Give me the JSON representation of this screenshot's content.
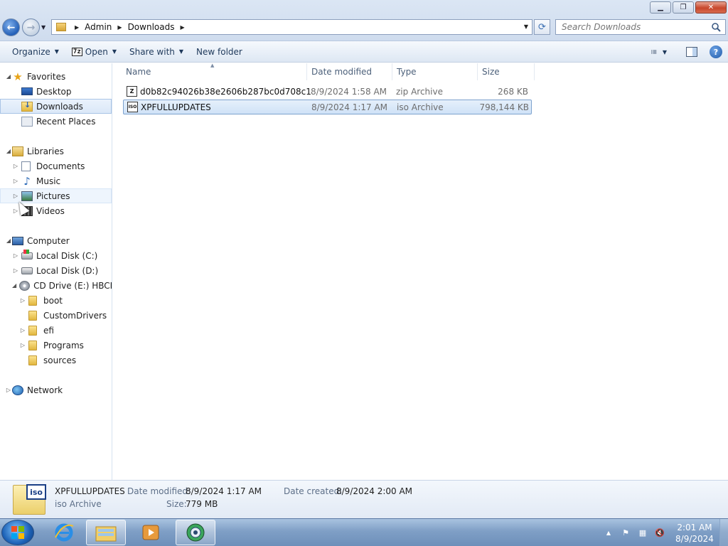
{
  "window": {
    "minimize": "▁",
    "restore": "❐",
    "close": "✕"
  },
  "address_bar": {
    "crumbs": [
      "Admin",
      "Downloads"
    ]
  },
  "search": {
    "placeholder": "Search Downloads"
  },
  "toolbar": {
    "organize": "Organize",
    "open_badge": "7z",
    "open": "Open",
    "share_with": "Share with",
    "new_folder": "New folder",
    "help": "?"
  },
  "nav": {
    "favorites": "Favorites",
    "desktop": "Desktop",
    "downloads": "Downloads",
    "recent_places": "Recent Places",
    "libraries": "Libraries",
    "documents": "Documents",
    "music": "Music",
    "pictures": "Pictures",
    "videos": "Videos",
    "computer": "Computer",
    "local_c": "Local Disk (C:)",
    "local_d": "Local Disk (D:)",
    "cd_drive": "CD Drive (E:) HBCD_",
    "boot": "boot",
    "custom_drivers": "CustomDrivers",
    "efi": "efi",
    "programs": "Programs",
    "sources": "sources",
    "network": "Network"
  },
  "columns": {
    "name": "Name",
    "date_modified": "Date modified",
    "type": "Type",
    "size": "Size"
  },
  "files": [
    {
      "icon_label": "Z",
      "name": "d0b82c94026b38e2606b287bc0d708c1",
      "date": "8/9/2024 1:58 AM",
      "type": "zip Archive",
      "size": "268 KB"
    },
    {
      "icon_label": "ISO",
      "name": "XPFULLUPDATES",
      "date": "8/9/2024 1:17 AM",
      "type": "iso Archive",
      "size": "798,144 KB"
    }
  ],
  "details": {
    "icon_badge": "iso",
    "name": "XPFULLUPDATES",
    "type": "iso Archive",
    "date_modified_label": "Date modified:",
    "date_modified": "8/9/2024 1:17 AM",
    "date_created_label": "Date created:",
    "date_created": "8/9/2024 2:00 AM",
    "size_label": "Size:",
    "size": "779 MB"
  },
  "taskbar": {
    "time": "2:01 AM",
    "date": "8/9/2024",
    "apps": [
      "internet-explorer",
      "windows-explorer",
      "media-player",
      "browser-globe"
    ]
  },
  "colors": {
    "selection_border": "#7da2ce",
    "selection_fill": "#cfe2f7",
    "taskbar": "#7f9fc6",
    "link_text": "#1e395b"
  }
}
